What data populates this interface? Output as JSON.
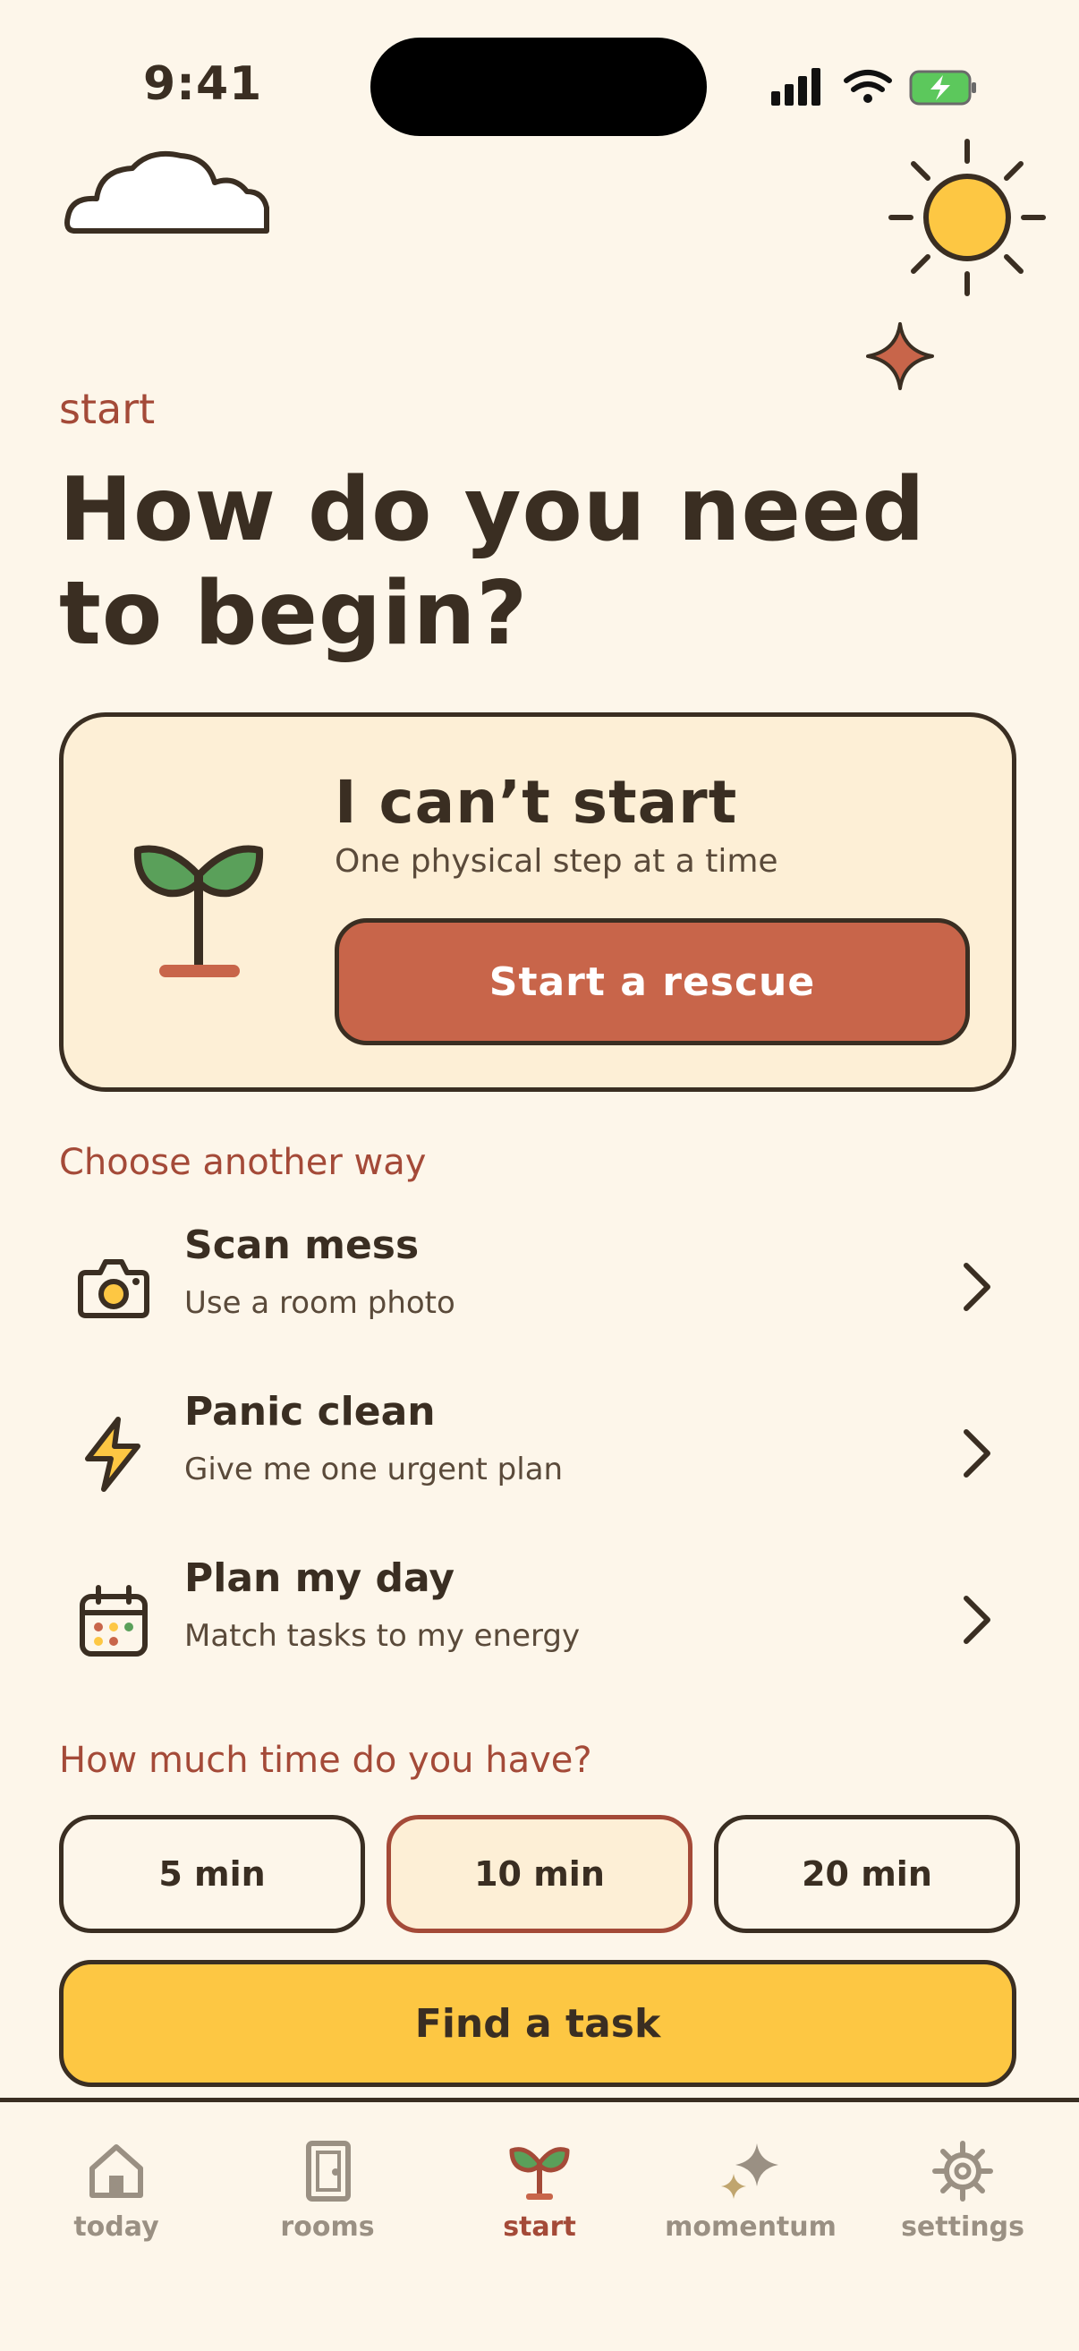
{
  "status_bar": {
    "time": "9:41"
  },
  "header": {
    "eyebrow": "start",
    "title": "How do you need to begin?"
  },
  "hero": {
    "title": "I can’t start",
    "subtitle": "One physical step at a time",
    "button_label": "Start a rescue",
    "icon": "sprout-icon"
  },
  "options_label": "Choose another way",
  "options": [
    {
      "title": "Scan mess",
      "subtitle": "Use a room photo",
      "icon": "camera-icon"
    },
    {
      "title": "Panic clean",
      "subtitle": "Give me one urgent plan",
      "icon": "lightning-icon"
    },
    {
      "title": "Plan my day",
      "subtitle": "Match tasks to my energy",
      "icon": "calendar-icon"
    }
  ],
  "time_label": "How much time do you have?",
  "time_options": [
    {
      "label": "5 min",
      "selected": false
    },
    {
      "label": "10 min",
      "selected": true
    },
    {
      "label": "20 min",
      "selected": false
    }
  ],
  "find_button": "Find a task",
  "tabs": [
    {
      "label": "today",
      "icon": "house-icon",
      "active": false
    },
    {
      "label": "rooms",
      "icon": "door-icon",
      "active": false
    },
    {
      "label": "start",
      "icon": "sprout-icon",
      "active": true
    },
    {
      "label": "momentum",
      "icon": "sparkle-icon",
      "active": false
    },
    {
      "label": "settings",
      "icon": "gear-icon",
      "active": false
    }
  ],
  "colors": {
    "background": "#fdf6ea",
    "ink": "#3a2e22",
    "accent": "#a44a38",
    "rescue_button": "#c8654a",
    "find_button": "#fdc743",
    "sun": "#fdc743",
    "battery": "#5cc85c"
  }
}
